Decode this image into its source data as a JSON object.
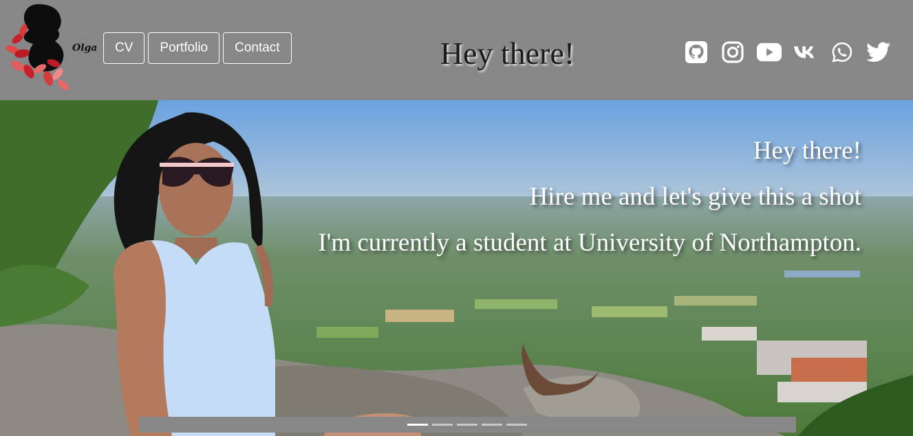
{
  "brand": {
    "name": "Olga"
  },
  "nav": {
    "items": [
      {
        "label": "CV"
      },
      {
        "label": "Portfolio"
      },
      {
        "label": "Contact"
      }
    ]
  },
  "header": {
    "title": "Hey there!"
  },
  "socials": [
    {
      "icon": "github-icon"
    },
    {
      "icon": "instagram-icon"
    },
    {
      "icon": "youtube-icon"
    },
    {
      "icon": "vk-icon"
    },
    {
      "icon": "whatsapp-icon"
    },
    {
      "icon": "twitter-icon"
    }
  ],
  "hero": {
    "lines": [
      "Hey there!",
      "Hire me and let's give this a shot",
      "I'm currently a student at University of Northampton."
    ]
  },
  "carousel": {
    "slide_count": 5,
    "active_index": 0
  },
  "colors": {
    "header_bg": "#878787",
    "text_light": "#ffffff"
  }
}
